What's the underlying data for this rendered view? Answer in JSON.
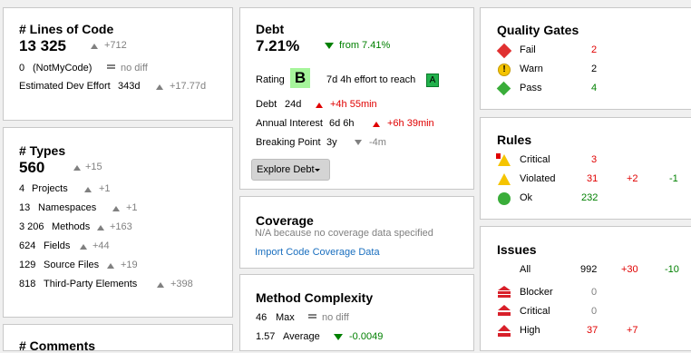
{
  "loc": {
    "title": "# Lines of Code",
    "value": "13 325",
    "delta": "+712",
    "notmycode_value": "0",
    "notmycode_label": "(NotMyCode)",
    "notmycode_delta": "no diff",
    "effort_label": "Estimated Dev Effort",
    "effort_value": "343d",
    "effort_delta": "+17.77d"
  },
  "types": {
    "title": "# Types",
    "value": "560",
    "delta": "+15",
    "rows": [
      {
        "value": "4",
        "label": "Projects",
        "delta": "+1"
      },
      {
        "value": "13",
        "label": "Namespaces",
        "delta": "+1"
      },
      {
        "value": "3 206",
        "label": "Methods",
        "delta": "+163"
      },
      {
        "value": "624",
        "label": "Fields",
        "delta": "+44"
      },
      {
        "value": "129",
        "label": "Source Files",
        "delta": "+19"
      },
      {
        "value": "818",
        "label": "Third-Party Elements",
        "delta": "+398"
      }
    ]
  },
  "comments": {
    "title": "# Comments"
  },
  "debt": {
    "title": "Debt",
    "value": "7.21%",
    "from": "from 7.41%",
    "rating_label": "Rating",
    "rating": "B",
    "effort_text": "7d  4h effort to reach",
    "target_rating": "A",
    "debt_label": "Debt",
    "debt_value": "24d",
    "debt_delta": "+4h  55min",
    "interest_label": "Annual Interest",
    "interest_value": "6d  6h",
    "interest_delta": "+6h  39min",
    "breaking_label": "Breaking Point",
    "breaking_value": "3y",
    "breaking_delta": "-4m",
    "explore_label": "Explore Debt"
  },
  "coverage": {
    "title": "Coverage",
    "note": "N/A because no coverage data specified",
    "import_link": "Import Code Coverage Data"
  },
  "method_complexity": {
    "title": "Method Complexity",
    "max_value": "46",
    "max_label": "Max",
    "max_delta": "no diff",
    "avg_value": "1.57",
    "avg_label": "Average",
    "avg_delta": "-0.0049"
  },
  "quality_gates": {
    "title": "Quality Gates",
    "fail_label": "Fail",
    "fail_value": "2",
    "warn_label": "Warn",
    "warn_value": "2",
    "pass_label": "Pass",
    "pass_value": "4"
  },
  "rules": {
    "title": "Rules",
    "critical_label": "Critical",
    "critical_value": "3",
    "violated_label": "Violated",
    "violated_value": "31",
    "violated_plus": "+2",
    "violated_minus": "-1",
    "ok_label": "Ok",
    "ok_value": "232"
  },
  "issues": {
    "title": "Issues",
    "all_label": "All",
    "all_value": "992",
    "all_plus": "+30",
    "all_minus": "-10",
    "blocker_label": "Blocker",
    "blocker_value": "0",
    "critical_label": "Critical",
    "critical_value": "0",
    "high_label": "High",
    "high_value": "37",
    "high_plus": "+7"
  },
  "colors": {
    "red": "#e00000",
    "green": "#008000",
    "gray": "#808080",
    "link": "#1a6fbf",
    "rating_b": "#a6f59b",
    "rating_a": "#22b14c"
  }
}
